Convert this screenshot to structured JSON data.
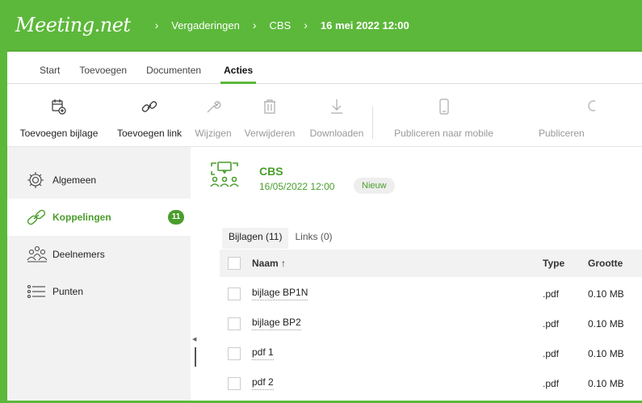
{
  "app": {
    "logo": "Meeting.net",
    "breadcrumb": [
      "Vergaderingen",
      "CBS"
    ],
    "breadcrumb_current": "16 mei 2022 12:00"
  },
  "tabs": [
    {
      "label": "Start"
    },
    {
      "label": "Toevoegen"
    },
    {
      "label": "Documenten"
    },
    {
      "label": "Acties",
      "active": true
    }
  ],
  "toolbar": {
    "add_attachment": "Toevoegen bijlage",
    "add_link": "Toevoegen link",
    "edit": "Wijzigen",
    "delete": "Verwijderen",
    "download": "Downloaden",
    "publish_mobile": "Publiceren naar mobile",
    "publish": "Publiceren"
  },
  "sidebar": {
    "items": [
      {
        "label": "Algemeen",
        "icon": "gear-icon"
      },
      {
        "label": "Koppelingen",
        "icon": "link-icon",
        "badge": "11",
        "active": true
      },
      {
        "label": "Deelnemers",
        "icon": "people-icon"
      },
      {
        "label": "Punten",
        "icon": "list-icon"
      }
    ]
  },
  "meeting": {
    "title": "CBS",
    "date": "16/05/2022 12:00",
    "status": "Nieuw"
  },
  "subtabs": [
    {
      "label": "Bijlagen (11)",
      "active": true
    },
    {
      "label": "Links (0)"
    }
  ],
  "table": {
    "headers": {
      "name": "Naam ↑",
      "type": "Type",
      "size": "Grootte"
    },
    "rows": [
      {
        "name": "bijlage BP1N",
        "type": ".pdf",
        "size": "0.10 MB"
      },
      {
        "name": "bijlage BP2",
        "type": ".pdf",
        "size": "0.10 MB"
      },
      {
        "name": "pdf 1",
        "type": ".pdf",
        "size": "0.10 MB"
      },
      {
        "name": "pdf 2",
        "type": ".pdf",
        "size": "0.10 MB"
      }
    ]
  },
  "colors": {
    "brand_green": "#5cb83a",
    "text_green": "#4a9d2c",
    "sidebar_bg": "#f2f2f2"
  }
}
